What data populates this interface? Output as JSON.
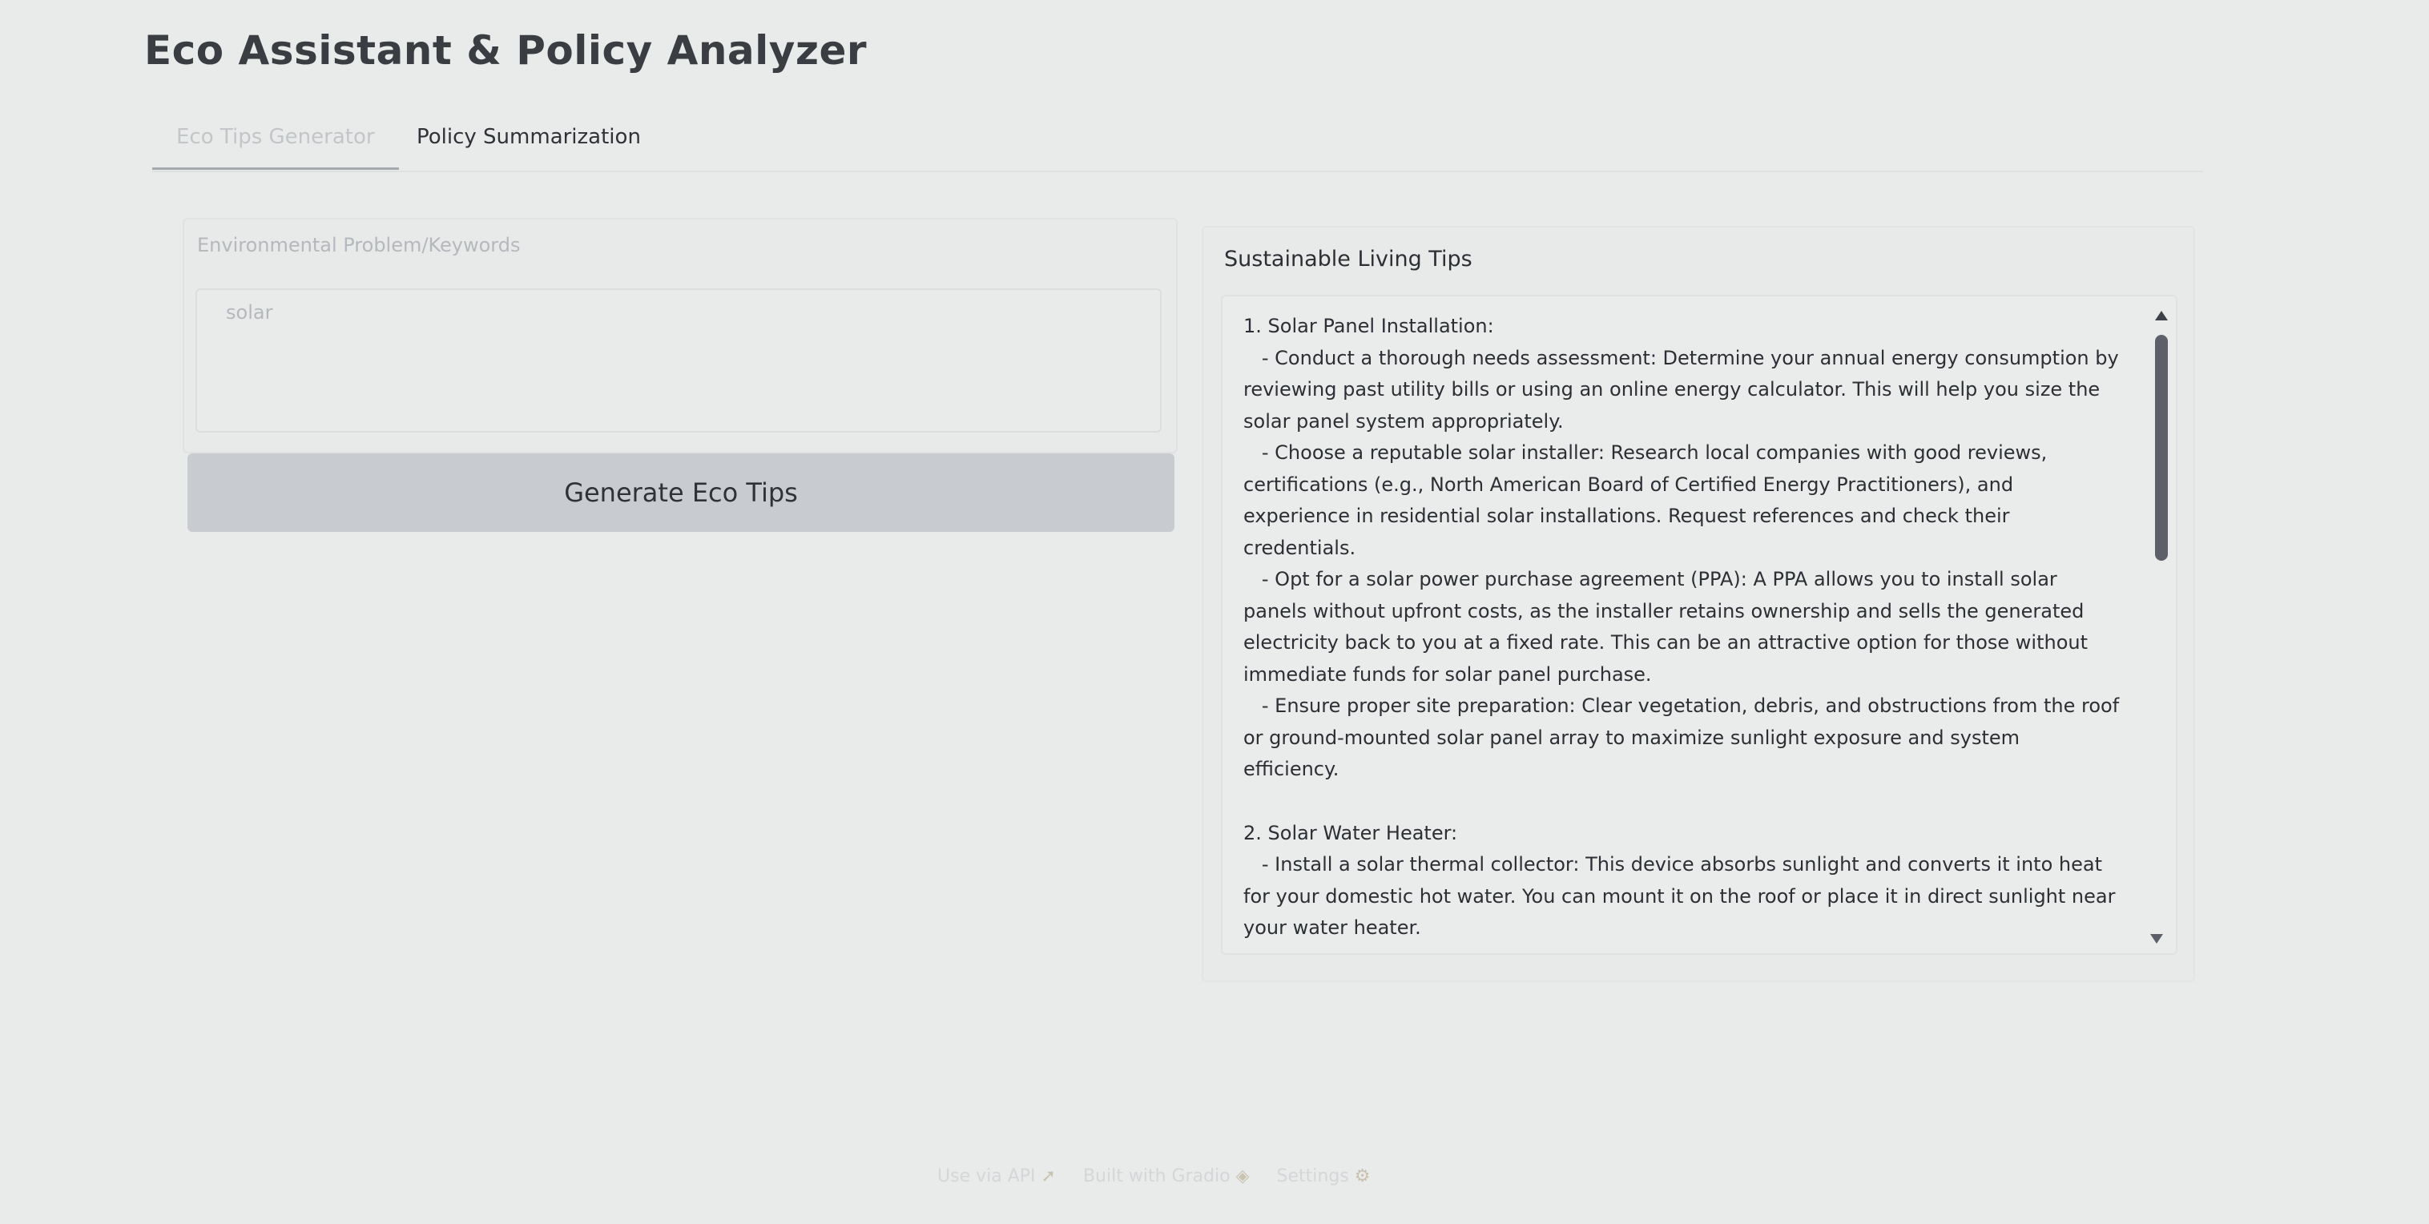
{
  "app": {
    "title": "Eco Assistant & Policy Analyzer"
  },
  "tabs": [
    {
      "label": "Eco Tips Generator",
      "active": true
    },
    {
      "label": "Policy Summarization",
      "active": false
    }
  ],
  "input": {
    "label": "Environmental Problem/Keywords",
    "value": "solar"
  },
  "generate_button": {
    "label": "Generate Eco Tips"
  },
  "output": {
    "label": "Sustainable Living Tips",
    "lines": [
      "1. Solar Panel Installation:",
      "   - Conduct a thorough needs assessment: Determine your annual energy consumption by",
      "reviewing past utility bills or using an online energy calculator. This will help you size the",
      "solar panel system appropriately.",
      "   - Choose a reputable solar installer: Research local companies with good reviews,",
      "certifications (e.g., North American Board of Certified Energy Practitioners), and",
      "experience in residential solar installations. Request references and check their",
      "credentials.",
      "   - Opt for a solar power purchase agreement (PPA): A PPA allows you to install solar",
      "panels without upfront costs, as the installer retains ownership and sells the generated",
      "electricity back to you at a fixed rate. This can be an attractive option for those without",
      "immediate funds for solar panel purchase.",
      "   - Ensure proper site preparation: Clear vegetation, debris, and obstructions from the roof",
      "or ground-mounted solar panel array to maximize sunlight exposure and system",
      "efficiency.",
      "",
      "2. Solar Water Heater:",
      "   - Install a solar thermal collector: This device absorbs sunlight and converts it into heat",
      "for your domestic hot water. You can mount it on the roof or place it in direct sunlight near",
      "your water heater."
    ]
  },
  "footer": {
    "api_label": "Use via API",
    "built_label": "Built with Gradio",
    "settings_label": "Settings"
  },
  "icons": {
    "api": "rocket-icon",
    "gradio": "gradio-logo-icon",
    "settings": "gear-icon"
  }
}
